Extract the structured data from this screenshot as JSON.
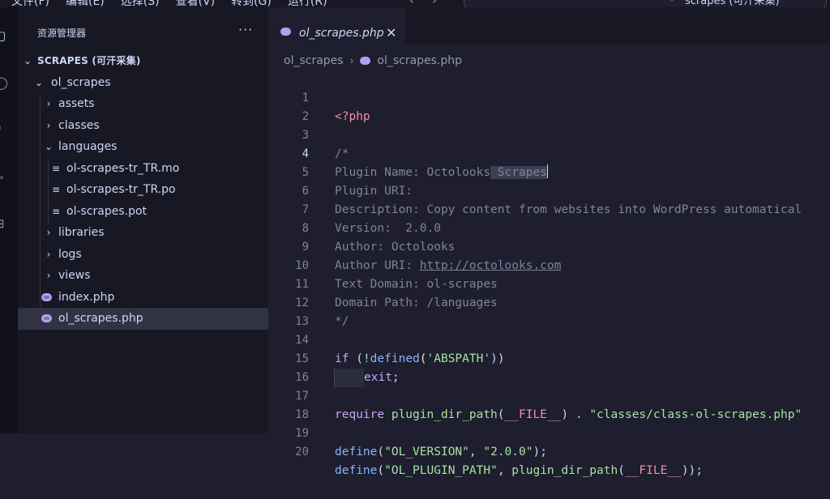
{
  "menubar": {
    "items": [
      "文件(F)",
      "编辑(E)",
      "选择(S)",
      "查看(V)",
      "转到(G)",
      "运行(R)"
    ],
    "nav_back": "‹",
    "nav_forward": "›",
    "command_center": "scrapes (可汗采集)"
  },
  "sidebar": {
    "title": "资源管理器",
    "more": "···",
    "section": "SCRAPES (可汗采集)",
    "root_folder": "ol_scrapes",
    "items": [
      {
        "label": "assets",
        "type": "folder",
        "expanded": false
      },
      {
        "label": "classes",
        "type": "folder",
        "expanded": false
      },
      {
        "label": "languages",
        "type": "folder",
        "expanded": true
      },
      {
        "label": "ol-scrapes-tr_TR.mo",
        "type": "file"
      },
      {
        "label": "ol-scrapes-tr_TR.po",
        "type": "file"
      },
      {
        "label": "ol-scrapes.pot",
        "type": "file"
      },
      {
        "label": "libraries",
        "type": "folder",
        "expanded": false
      },
      {
        "label": "logs",
        "type": "folder",
        "expanded": false
      },
      {
        "label": "views",
        "type": "folder",
        "expanded": false
      },
      {
        "label": "index.php",
        "type": "php"
      },
      {
        "label": "ol_scrapes.php",
        "type": "php",
        "selected": true
      }
    ]
  },
  "editor": {
    "tab_label": "ol_scrapes.php",
    "tab_close": "✕",
    "breadcrumb": [
      "ol_scrapes",
      "ol_scrapes.php"
    ],
    "current_line": 4,
    "lines": {
      "l1": "<?php",
      "l3": "/*",
      "l4a": "Plugin Name: Octolooks",
      "l4b": " Scrapes",
      "l5": "Plugin URI:",
      "l6": "Description: Copy content from websites into WordPress automatical",
      "l7": "Version:  2.0.0",
      "l8": "Author: Octolooks",
      "l9a": "Author URI: ",
      "l9b": "http://octolooks.com",
      "l10": "Text Domain: ol-scrapes",
      "l11": "Domain Path: /languages",
      "l12": "*/",
      "l14_if": "if",
      "l14_open": " (",
      "l14_not": "!",
      "l14_fn": "defined",
      "l14_p1": "(",
      "l14_str": "'ABSPATH'",
      "l14_p2": "))",
      "l15_kw": "exit",
      "l15_semi": ";",
      "l17_kw": "require",
      "l17_fn": " plugin_dir_path",
      "l17_p1": "(",
      "l17_const": "__FILE__",
      "l17_p2": ")",
      "l17_dot": " . ",
      "l17_str": "\"classes/class-ol-scrapes.php\"",
      "l19_fn": "define",
      "l19_p1": "(",
      "l19_s1": "\"OL_VERSION\"",
      "l19_c": ", ",
      "l19_s2": "\"2.0.0\"",
      "l19_p2": ");",
      "l20_fn": "define",
      "l20_p1": "(",
      "l20_s1": "\"OL_PLUGIN_PATH\"",
      "l20_c": ", ",
      "l20_fn2": "plugin_dir_path",
      "l20_p2": "(",
      "l20_const": "__FILE__",
      "l20_p3": "));"
    },
    "line_numbers": [
      "1",
      "2",
      "3",
      "4",
      "5",
      "6",
      "7",
      "8",
      "9",
      "10",
      "11",
      "12",
      "13",
      "14",
      "15",
      "16",
      "17",
      "18",
      "19",
      "20"
    ]
  },
  "colors": {
    "background": "#1e1e2e",
    "sidebar": "#181825",
    "keyword": "#cba6f7",
    "function": "#89b4fa",
    "string": "#a6e3a1",
    "comment": "#7f849c"
  },
  "icons": [
    "explorer-icon",
    "search-icon",
    "source-control-icon",
    "run-debug-icon",
    "extensions-icon",
    "php-elephant-icon",
    "file-lines-icon",
    "chevron-right-icon",
    "chevron-down-icon"
  ]
}
